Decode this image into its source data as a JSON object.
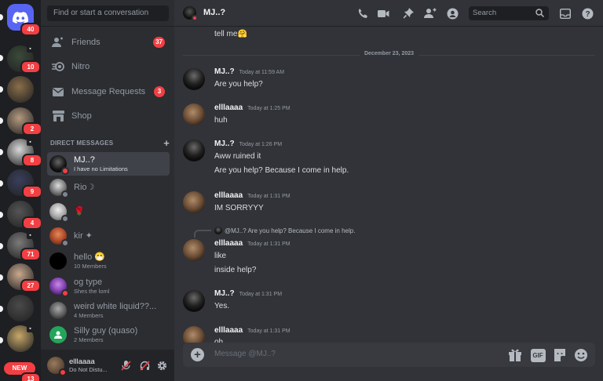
{
  "rail": {
    "home_badge": "40",
    "servers": [
      {
        "badge": "10",
        "color": "#3a4a3a"
      },
      {
        "badge": "",
        "color": "#8a6e4a"
      },
      {
        "badge": "2",
        "color": "#b59a80"
      },
      {
        "badge": "8",
        "color": "#d9d9d9"
      },
      {
        "badge": "9",
        "color": "#3a3f5c"
      },
      {
        "badge": "4",
        "color": "#555555"
      },
      {
        "badge": "71",
        "color": "#7a7a7a"
      },
      {
        "badge": "27",
        "color": "#c9a98f"
      },
      {
        "badge": "",
        "color": "#4a4a4a"
      },
      {
        "badge": "",
        "color": "#c7a86a"
      }
    ],
    "new_badge": "NEW",
    "bottom_badge": "13"
  },
  "sidebar": {
    "search_placeholder": "Find or start a conversation",
    "nav": [
      {
        "label": "Friends",
        "badge": "37",
        "icon": "friends-icon"
      },
      {
        "label": "Nitro",
        "badge": "",
        "icon": "nitro-icon"
      },
      {
        "label": "Message Requests",
        "badge": "3",
        "icon": "envelope-icon"
      },
      {
        "label": "Shop",
        "badge": "",
        "icon": "shop-icon"
      }
    ],
    "dm_header": "DIRECT MESSAGES",
    "dms": [
      {
        "name": "MJ..?",
        "sub": "I have no Limitations",
        "color": "#111111",
        "status": "#f23f43",
        "active": true
      },
      {
        "name": "Rio☽",
        "sub": "",
        "color": "#9a9a9a",
        "status": "#80848e",
        "active": false
      },
      {
        "name": "🌹",
        "sub": "",
        "color": "#cfcfcf",
        "status": "#80848e",
        "active": false
      },
      {
        "name": "kir ✦",
        "sub": "",
        "color": "#c0623a",
        "status": "#80848e",
        "active": false
      },
      {
        "name": "hello 😷",
        "sub": "10 Members",
        "color": "#000000",
        "status": "",
        "active": false
      },
      {
        "name": "og type",
        "sub": "Shes the loml",
        "color": "#7a3aa8",
        "status": "#f23f43",
        "active": false
      },
      {
        "name": "weird white liquid??...",
        "sub": "4 Members",
        "color": "#6a6a6a",
        "status": "",
        "active": false
      },
      {
        "name": "Silly guy (quaso)",
        "sub": "2 Members",
        "color": "#23a55a",
        "status": "",
        "active": false
      }
    ],
    "user": {
      "name": "elllaaaa",
      "status": "Do Not Distu..."
    }
  },
  "header": {
    "title": "MJ..?",
    "search_placeholder": "Search"
  },
  "chat": {
    "top_text": "tell me🤗",
    "date_divider": "December 23, 2023",
    "messages": [
      {
        "author": "MJ..?",
        "time": "Today at 11:59 AM",
        "lines": [
          "Are you help?"
        ]
      },
      {
        "author": "elllaaaa",
        "time": "Today at 1:25 PM",
        "lines": [
          "huh"
        ]
      },
      {
        "author": "MJ..?",
        "time": "Today at 1:26 PM",
        "lines": [
          "Aww ruined it",
          "Are you help? Because I come in help."
        ]
      },
      {
        "author": "elllaaaa",
        "time": "Today at 1:31 PM",
        "lines": [
          "IM SORRYYY"
        ]
      },
      {
        "author": "elllaaaa",
        "time": "Today at 1:31 PM",
        "lines": [
          "like",
          "inside help?"
        ],
        "reply": "@MJ..? Are you help? Because I come in help."
      },
      {
        "author": "MJ..?",
        "time": "Today at 1:31 PM",
        "lines": [
          "Yes."
        ]
      },
      {
        "author": "elllaaaa",
        "time": "Today at 1:31 PM",
        "lines": [
          "oh"
        ]
      }
    ]
  },
  "composer": {
    "placeholder": "Message @MJ..?",
    "gif_label": "GIF"
  }
}
